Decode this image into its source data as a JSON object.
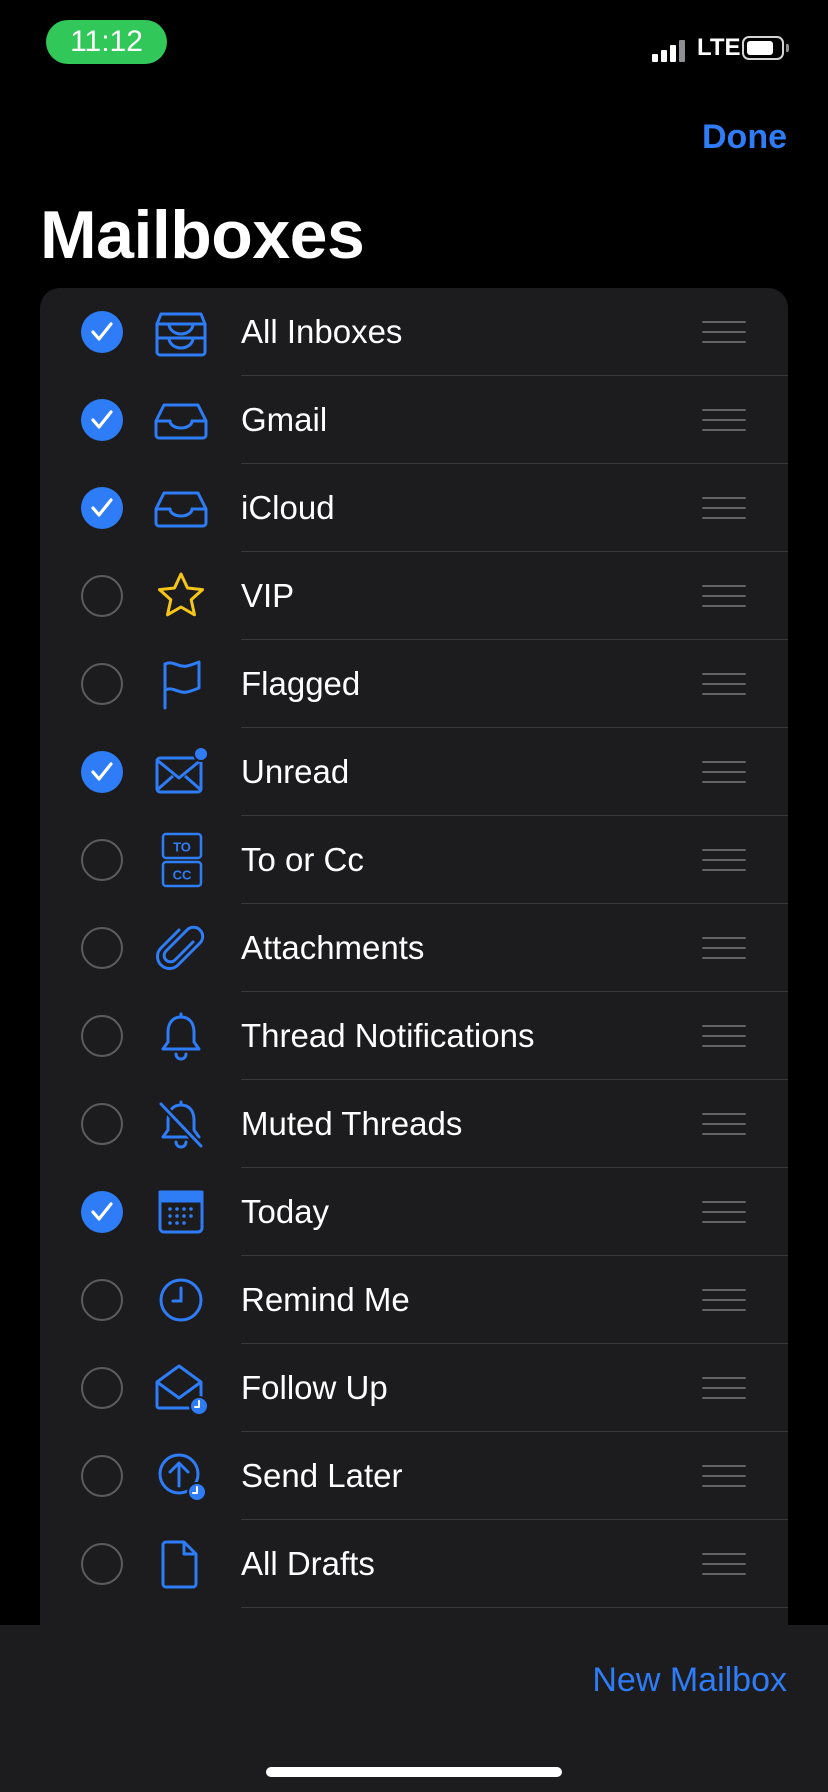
{
  "status_bar": {
    "time": "11:12",
    "network": "LTE"
  },
  "nav": {
    "done_label": "Done"
  },
  "page": {
    "title": "Mailboxes"
  },
  "colors": {
    "accent": "#2e7cf6",
    "vip_star": "#f5c518",
    "time_pill": "#31c759"
  },
  "mailboxes": [
    {
      "label": "All Inboxes",
      "checked": true,
      "icon": "all-inboxes-icon"
    },
    {
      "label": "Gmail",
      "checked": true,
      "icon": "inbox-icon"
    },
    {
      "label": "iCloud",
      "checked": true,
      "icon": "inbox-icon"
    },
    {
      "label": "VIP",
      "checked": false,
      "icon": "star-icon"
    },
    {
      "label": "Flagged",
      "checked": false,
      "icon": "flag-icon"
    },
    {
      "label": "Unread",
      "checked": true,
      "icon": "unread-envelope-icon"
    },
    {
      "label": "To or Cc",
      "checked": false,
      "icon": "to-cc-icon",
      "icon_text": [
        "TO",
        "CC"
      ]
    },
    {
      "label": "Attachments",
      "checked": false,
      "icon": "paperclip-icon"
    },
    {
      "label": "Thread Notifications",
      "checked": false,
      "icon": "bell-icon"
    },
    {
      "label": "Muted Threads",
      "checked": false,
      "icon": "muted-bell-icon"
    },
    {
      "label": "Today",
      "checked": true,
      "icon": "calendar-icon"
    },
    {
      "label": "Remind Me",
      "checked": false,
      "icon": "clock-icon"
    },
    {
      "label": "Follow Up",
      "checked": false,
      "icon": "follow-up-envelope-icon"
    },
    {
      "label": "Send Later",
      "checked": false,
      "icon": "send-later-icon"
    },
    {
      "label": "All Drafts",
      "checked": false,
      "icon": "document-icon"
    }
  ],
  "toolbar": {
    "new_mailbox_label": "New Mailbox"
  }
}
